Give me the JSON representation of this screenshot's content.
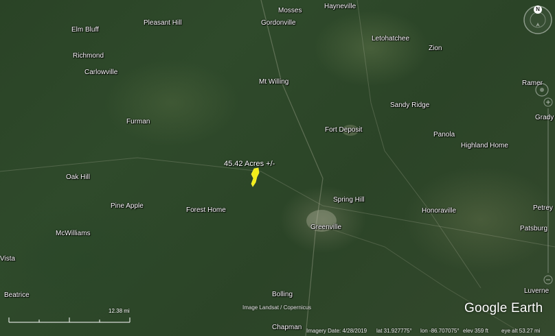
{
  "places": [
    {
      "name": "Hayneville"
    },
    {
      "name": "Mosses"
    },
    {
      "name": "Elm Bluff"
    },
    {
      "name": "Pleasant Hill"
    },
    {
      "name": "Gordonville"
    },
    {
      "name": "Letohatchee"
    },
    {
      "name": "Zion"
    },
    {
      "name": "Richmond"
    },
    {
      "name": "Carlowville"
    },
    {
      "name": "Mt Willing"
    },
    {
      "name": "Ramer"
    },
    {
      "name": "Sandy Ridge"
    },
    {
      "name": "Furman"
    },
    {
      "name": "Fort Deposit"
    },
    {
      "name": "Grady"
    },
    {
      "name": "Panola"
    },
    {
      "name": "Highland Home"
    },
    {
      "name": "Oak Hill"
    },
    {
      "name": "Spring Hill"
    },
    {
      "name": "Pine Apple"
    },
    {
      "name": "Forest Home"
    },
    {
      "name": "Honoraville"
    },
    {
      "name": "Petrey"
    },
    {
      "name": "Greenville"
    },
    {
      "name": "McWilliams"
    },
    {
      "name": "Patsburg"
    },
    {
      "name": "Vista"
    },
    {
      "name": "Beatrice"
    },
    {
      "name": "Bolling"
    },
    {
      "name": "Luverne"
    },
    {
      "name": "Chapman"
    }
  ],
  "parcel": {
    "label": "45.42 Acres +/-",
    "color": "#f2ee1a"
  },
  "compass": {
    "north_label": "N"
  },
  "scale": {
    "label": "12.38 mi"
  },
  "credits": {
    "imagery": "Image Landsat / Copernicus"
  },
  "logo": {
    "text": "Google Earth"
  },
  "status": {
    "imagery_date": "Imagery Date: 4/28/2019",
    "lat": "lat   31.927775°",
    "lon": "lon  -86.707075°",
    "elev": "elev   359 ft",
    "eye_alt": "eye alt  53.27 mi"
  },
  "colors": {
    "forest": "#2f4a2b",
    "parcel": "#f2ee1a",
    "label_text": "#ffffff"
  }
}
